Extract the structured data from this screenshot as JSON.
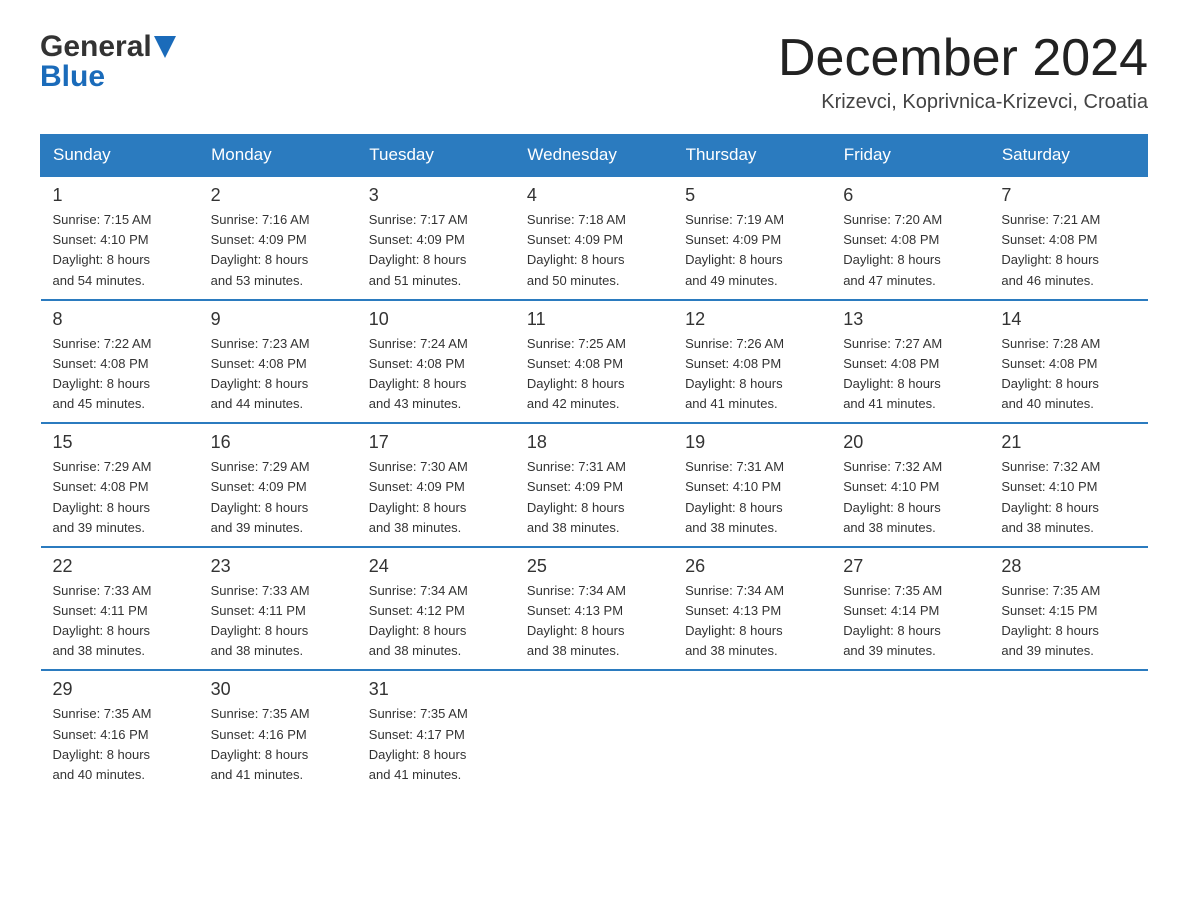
{
  "header": {
    "logo_line1": "General",
    "logo_line2": "Blue",
    "month_title": "December 2024",
    "location": "Krizevci, Koprivnica-Krizevci, Croatia"
  },
  "weekdays": [
    "Sunday",
    "Monday",
    "Tuesday",
    "Wednesday",
    "Thursday",
    "Friday",
    "Saturday"
  ],
  "weeks": [
    [
      {
        "day": "1",
        "sunrise": "7:15 AM",
        "sunset": "4:10 PM",
        "daylight": "8 hours and 54 minutes."
      },
      {
        "day": "2",
        "sunrise": "7:16 AM",
        "sunset": "4:09 PM",
        "daylight": "8 hours and 53 minutes."
      },
      {
        "day": "3",
        "sunrise": "7:17 AM",
        "sunset": "4:09 PM",
        "daylight": "8 hours and 51 minutes."
      },
      {
        "day": "4",
        "sunrise": "7:18 AM",
        "sunset": "4:09 PM",
        "daylight": "8 hours and 50 minutes."
      },
      {
        "day": "5",
        "sunrise": "7:19 AM",
        "sunset": "4:09 PM",
        "daylight": "8 hours and 49 minutes."
      },
      {
        "day": "6",
        "sunrise": "7:20 AM",
        "sunset": "4:08 PM",
        "daylight": "8 hours and 47 minutes."
      },
      {
        "day": "7",
        "sunrise": "7:21 AM",
        "sunset": "4:08 PM",
        "daylight": "8 hours and 46 minutes."
      }
    ],
    [
      {
        "day": "8",
        "sunrise": "7:22 AM",
        "sunset": "4:08 PM",
        "daylight": "8 hours and 45 minutes."
      },
      {
        "day": "9",
        "sunrise": "7:23 AM",
        "sunset": "4:08 PM",
        "daylight": "8 hours and 44 minutes."
      },
      {
        "day": "10",
        "sunrise": "7:24 AM",
        "sunset": "4:08 PM",
        "daylight": "8 hours and 43 minutes."
      },
      {
        "day": "11",
        "sunrise": "7:25 AM",
        "sunset": "4:08 PM",
        "daylight": "8 hours and 42 minutes."
      },
      {
        "day": "12",
        "sunrise": "7:26 AM",
        "sunset": "4:08 PM",
        "daylight": "8 hours and 41 minutes."
      },
      {
        "day": "13",
        "sunrise": "7:27 AM",
        "sunset": "4:08 PM",
        "daylight": "8 hours and 41 minutes."
      },
      {
        "day": "14",
        "sunrise": "7:28 AM",
        "sunset": "4:08 PM",
        "daylight": "8 hours and 40 minutes."
      }
    ],
    [
      {
        "day": "15",
        "sunrise": "7:29 AM",
        "sunset": "4:08 PM",
        "daylight": "8 hours and 39 minutes."
      },
      {
        "day": "16",
        "sunrise": "7:29 AM",
        "sunset": "4:09 PM",
        "daylight": "8 hours and 39 minutes."
      },
      {
        "day": "17",
        "sunrise": "7:30 AM",
        "sunset": "4:09 PM",
        "daylight": "8 hours and 38 minutes."
      },
      {
        "day": "18",
        "sunrise": "7:31 AM",
        "sunset": "4:09 PM",
        "daylight": "8 hours and 38 minutes."
      },
      {
        "day": "19",
        "sunrise": "7:31 AM",
        "sunset": "4:10 PM",
        "daylight": "8 hours and 38 minutes."
      },
      {
        "day": "20",
        "sunrise": "7:32 AM",
        "sunset": "4:10 PM",
        "daylight": "8 hours and 38 minutes."
      },
      {
        "day": "21",
        "sunrise": "7:32 AM",
        "sunset": "4:10 PM",
        "daylight": "8 hours and 38 minutes."
      }
    ],
    [
      {
        "day": "22",
        "sunrise": "7:33 AM",
        "sunset": "4:11 PM",
        "daylight": "8 hours and 38 minutes."
      },
      {
        "day": "23",
        "sunrise": "7:33 AM",
        "sunset": "4:11 PM",
        "daylight": "8 hours and 38 minutes."
      },
      {
        "day": "24",
        "sunrise": "7:34 AM",
        "sunset": "4:12 PM",
        "daylight": "8 hours and 38 minutes."
      },
      {
        "day": "25",
        "sunrise": "7:34 AM",
        "sunset": "4:13 PM",
        "daylight": "8 hours and 38 minutes."
      },
      {
        "day": "26",
        "sunrise": "7:34 AM",
        "sunset": "4:13 PM",
        "daylight": "8 hours and 38 minutes."
      },
      {
        "day": "27",
        "sunrise": "7:35 AM",
        "sunset": "4:14 PM",
        "daylight": "8 hours and 39 minutes."
      },
      {
        "day": "28",
        "sunrise": "7:35 AM",
        "sunset": "4:15 PM",
        "daylight": "8 hours and 39 minutes."
      }
    ],
    [
      {
        "day": "29",
        "sunrise": "7:35 AM",
        "sunset": "4:16 PM",
        "daylight": "8 hours and 40 minutes."
      },
      {
        "day": "30",
        "sunrise": "7:35 AM",
        "sunset": "4:16 PM",
        "daylight": "8 hours and 41 minutes."
      },
      {
        "day": "31",
        "sunrise": "7:35 AM",
        "sunset": "4:17 PM",
        "daylight": "8 hours and 41 minutes."
      },
      null,
      null,
      null,
      null
    ]
  ]
}
